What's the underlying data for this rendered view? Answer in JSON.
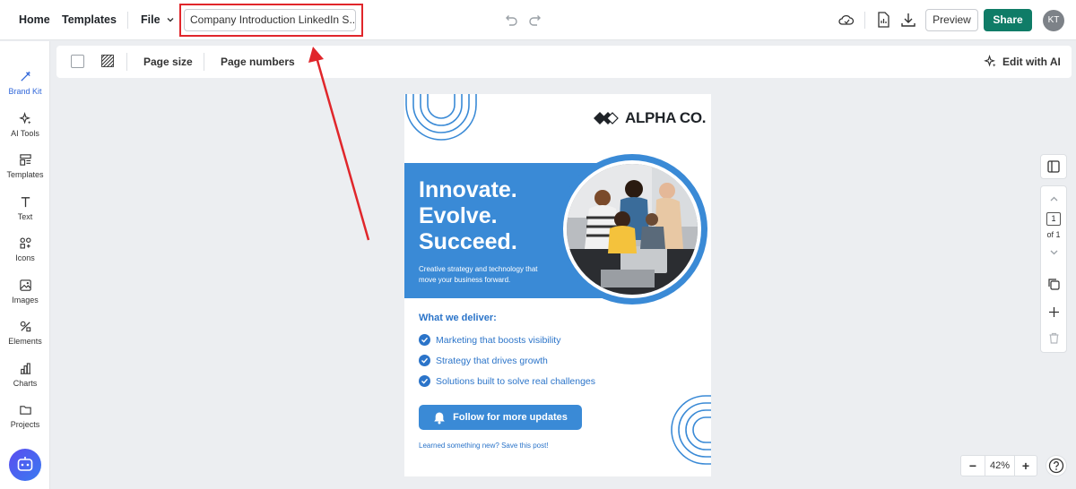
{
  "topbar": {
    "home": "Home",
    "templates": "Templates",
    "file": "File",
    "doc_title": "Company Introduction LinkedIn S...",
    "preview": "Preview",
    "share": "Share",
    "avatar": "KT"
  },
  "sidebar": {
    "items": [
      {
        "label": "Brand Kit",
        "icon": "brand-kit-icon",
        "active": true
      },
      {
        "label": "AI Tools",
        "icon": "sparkle-icon"
      },
      {
        "label": "Templates",
        "icon": "templates-icon"
      },
      {
        "label": "Text",
        "icon": "text-icon"
      },
      {
        "label": "Icons",
        "icon": "shapes-icon"
      },
      {
        "label": "Images",
        "icon": "image-icon"
      },
      {
        "label": "Elements",
        "icon": "elements-icon"
      },
      {
        "label": "Charts",
        "icon": "chart-icon"
      },
      {
        "label": "Projects",
        "icon": "folder-icon"
      }
    ]
  },
  "toolbar": {
    "page_size": "Page size",
    "page_numbers": "Page numbers",
    "edit_with_ai": "Edit with AI"
  },
  "design": {
    "logo": "ALPHA CO.",
    "headline": [
      "Innovate.",
      "Evolve.",
      "Succeed."
    ],
    "subline": "Creative strategy and technology that move your business forward.",
    "deliver_title": "What we deliver:",
    "deliver_items": [
      "Marketing that boosts visibility",
      "Strategy that drives growth",
      "Solutions built to solve real challenges"
    ],
    "cta": "Follow for more updates",
    "footer_note": "Learned something new? Save this post!"
  },
  "pager": {
    "current": "1",
    "of": "of 1"
  },
  "zoom": {
    "value": "42%",
    "minus": "−",
    "plus": "+"
  },
  "colors": {
    "accent": "#3a8ad6",
    "share": "#0f7c67",
    "highlight": "#e0262b"
  }
}
